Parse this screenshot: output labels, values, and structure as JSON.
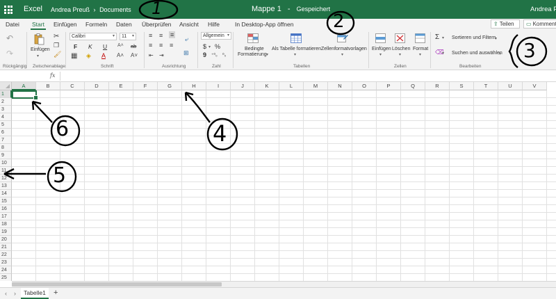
{
  "titlebar": {
    "app_name": "Excel",
    "owner": "Andrea Preuß",
    "separator": "›",
    "folder": "Documents",
    "document": "Mappe 1",
    "dash": "-",
    "status": "Gespeichert",
    "user": "Andrea Pre"
  },
  "menu": {
    "tabs": [
      "Datei",
      "Start",
      "Einfügen",
      "Formeln",
      "Daten",
      "Überprüfen",
      "Ansicht",
      "Hilfe",
      "In Desktop-App öffnen"
    ],
    "active_tab": "Start",
    "share": "Teilen",
    "comments": "Komment"
  },
  "ribbon": {
    "groups": {
      "undo": "Rückgängig",
      "clipboard": "Zwischenablage",
      "font": "Schrift",
      "alignment": "Ausrichtung",
      "number": "Zahl",
      "tables": "Tabellen",
      "cells": "Zellen",
      "editing": "Bearbeiten"
    },
    "paste_label": "Einfügen",
    "font_name": "Calibri",
    "font_size": "11",
    "bold": "F",
    "italic": "K",
    "underline": "U",
    "strikethrough": "ab",
    "number_format": "Allgemein",
    "currency": "$",
    "percent": "%",
    "comma": "9",
    "conditional_formatting_1": "Bedingte",
    "conditional_formatting_2": "Formatierung",
    "format_as_table": "Als Tabelle formatieren",
    "cell_styles": "Zellenformatvorlagen",
    "insert_cells": "Einfügen",
    "delete_cells": "Löschen",
    "format_cells": "Format",
    "autosum": "Σ",
    "sort_filter": "Sortieren und Filtern",
    "find_select": "Suchen und auswählen"
  },
  "formula_bar": {
    "fx": "fx"
  },
  "grid": {
    "columns": [
      "A",
      "B",
      "C",
      "D",
      "E",
      "F",
      "G",
      "H",
      "I",
      "J",
      "K",
      "L",
      "M",
      "N",
      "O",
      "P",
      "Q",
      "R",
      "S",
      "T",
      "U",
      "V"
    ],
    "rows": [
      "1",
      "2",
      "3",
      "4",
      "5",
      "6",
      "7",
      "8",
      "9",
      "10",
      "11",
      "12",
      "13",
      "14",
      "15",
      "16",
      "17",
      "18",
      "19",
      "20",
      "21",
      "22",
      "23",
      "24",
      "25"
    ],
    "active_cell": "A1"
  },
  "sheets": {
    "tabs": [
      "Tabelle1"
    ],
    "add": "+",
    "prev": "‹",
    "next": "›"
  },
  "annotations": [
    "1",
    "2",
    "3",
    "4",
    "5",
    "6"
  ],
  "colors": {
    "accent": "#217346",
    "ribbon_bg": "#f3f3f3"
  }
}
